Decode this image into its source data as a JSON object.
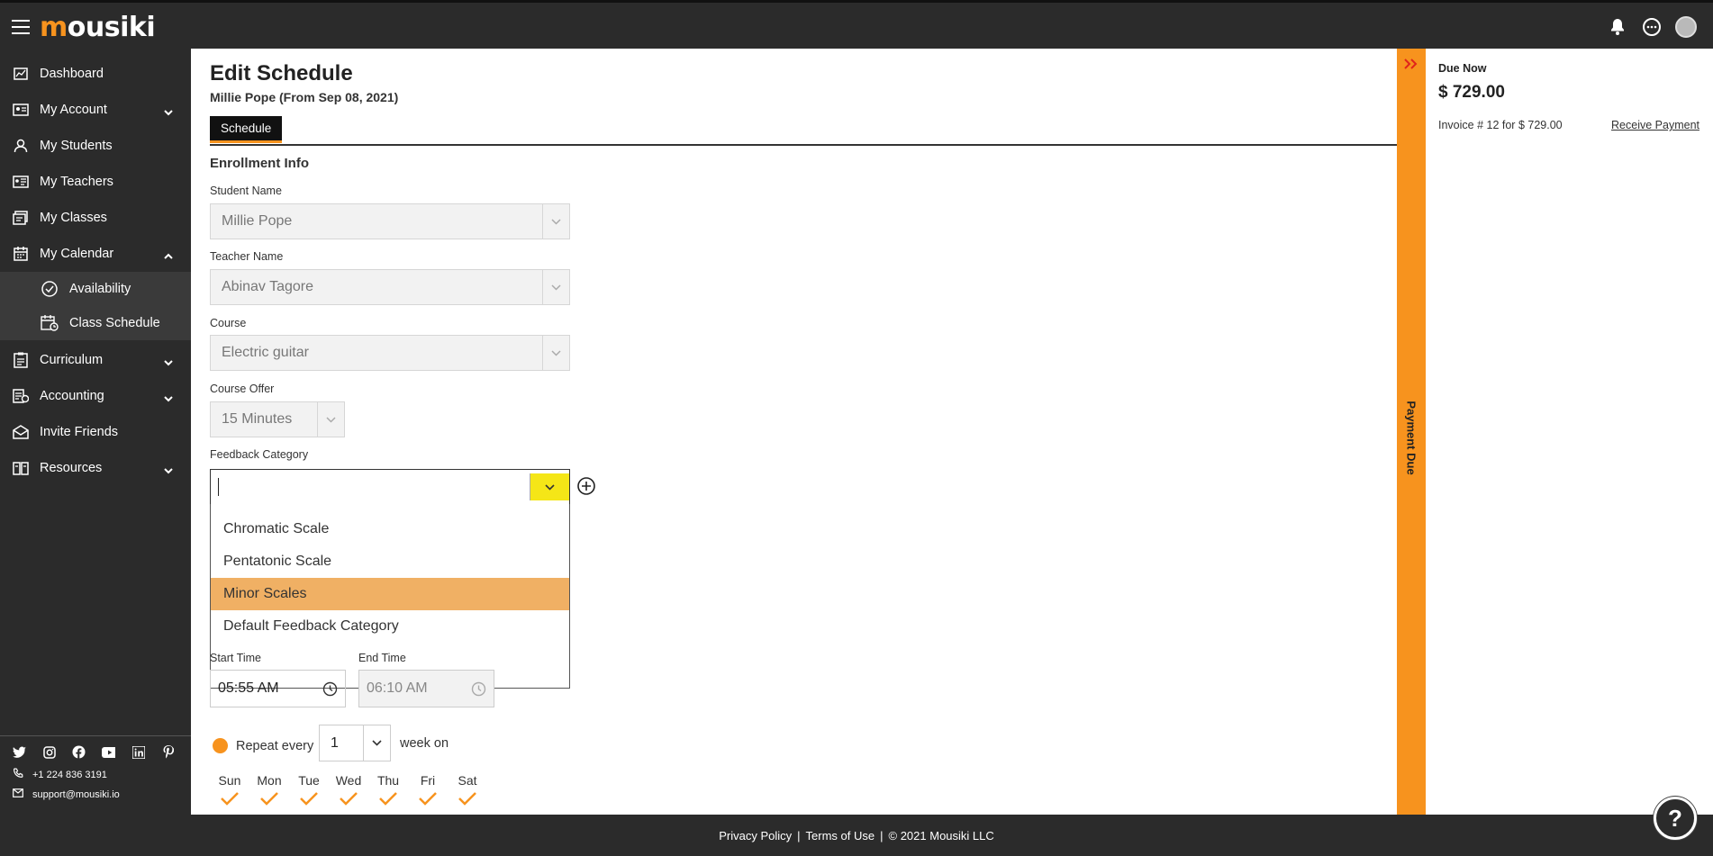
{
  "header": {
    "logo_text": "ousiki",
    "logo_letter": "m"
  },
  "sidebar": {
    "items": [
      {
        "label": "Dashboard",
        "icon": "chart-icon"
      },
      {
        "label": "My Account",
        "icon": "id-card-icon"
      },
      {
        "label": "My Students",
        "icon": "user-icon"
      },
      {
        "label": "My Teachers",
        "icon": "teacher-board-icon"
      },
      {
        "label": "My Classes",
        "icon": "classes-icon"
      },
      {
        "label": "My Calendar",
        "icon": "calendar-icon"
      },
      {
        "label": "Curriculum",
        "icon": "clipboard-icon"
      },
      {
        "label": "Accounting",
        "icon": "accounting-icon"
      },
      {
        "label": "Invite Friends",
        "icon": "envelope-icon"
      },
      {
        "label": "Resources",
        "icon": "book-icon"
      }
    ],
    "calendar_sub": [
      {
        "label": "Availability",
        "icon": "clock-check-icon"
      },
      {
        "label": "Class Schedule",
        "icon": "calendar-clock-icon"
      }
    ],
    "phone": "+1 224 836 3191",
    "email": "support@mousiki.io"
  },
  "page": {
    "title": "Edit Schedule",
    "subtitle": "Millie Pope (From Sep 08, 2021)",
    "tab": "Schedule",
    "section": "Enrollment Info"
  },
  "form": {
    "student_label": "Student Name",
    "student_value": "Millie Pope",
    "teacher_label": "Teacher Name",
    "teacher_value": "Abinav Tagore",
    "course_label": "Course",
    "course_value": "Electric guitar",
    "offer_label": "Course Offer",
    "offer_value": "15 Minutes",
    "feedback_label": "Feedback Category",
    "feedback_options": [
      "Chromatic Scale",
      "Pentatonic Scale",
      "Minor Scales",
      "Default Feedback Category"
    ],
    "feedback_highlighted": "Minor Scales",
    "start_label": "Start Time",
    "start_value": "05:55 AM",
    "end_label": "End Time",
    "end_value": "06:10 AM",
    "repeat_label": "Repeat every",
    "repeat_value": "1",
    "week_label": "week on",
    "days": [
      "Sun",
      "Mon",
      "Tue",
      "Wed",
      "Thu",
      "Fri",
      "Sat"
    ]
  },
  "payment": {
    "strip_label": "Payment Due",
    "due_label": "Due Now",
    "due_amount": "$ 729.00",
    "invoice_text": "Invoice # 12 for $ 729.00",
    "receive_label": "Receive Payment"
  },
  "footer": {
    "privacy": "Privacy Policy",
    "terms": "Terms of Use",
    "copyright": "© 2021 Mousiki LLC",
    "sep": "|"
  },
  "help_label": "?",
  "colors": {
    "accent": "#f7931e",
    "dark": "#2b2b2b",
    "highlight": "#f0b064",
    "yellow": "#f5e617"
  }
}
